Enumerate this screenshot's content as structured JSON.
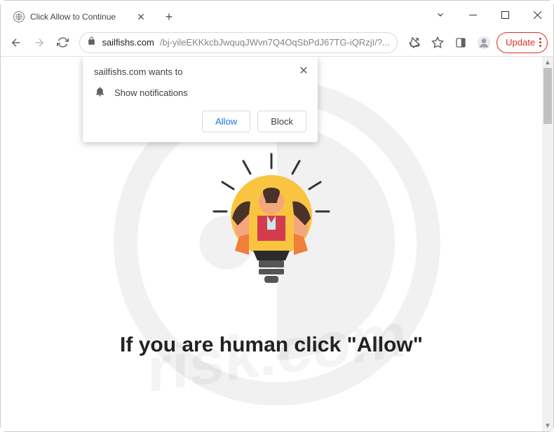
{
  "window": {
    "tab_title": "Click Allow to Continue"
  },
  "toolbar": {
    "url_host": "sailfishs.com",
    "url_path": "/bj-yileEKKkcbJwquqJWvn7Q4OqSbPdJ67TG-iQRzjI/?...",
    "update_label": "Update"
  },
  "permission": {
    "title": "sailfishs.com wants to",
    "request": "Show notifications",
    "allow": "Allow",
    "block": "Block"
  },
  "page": {
    "headline": "If you are human click \"Allow\""
  },
  "watermark": {
    "text": "risk.com"
  }
}
